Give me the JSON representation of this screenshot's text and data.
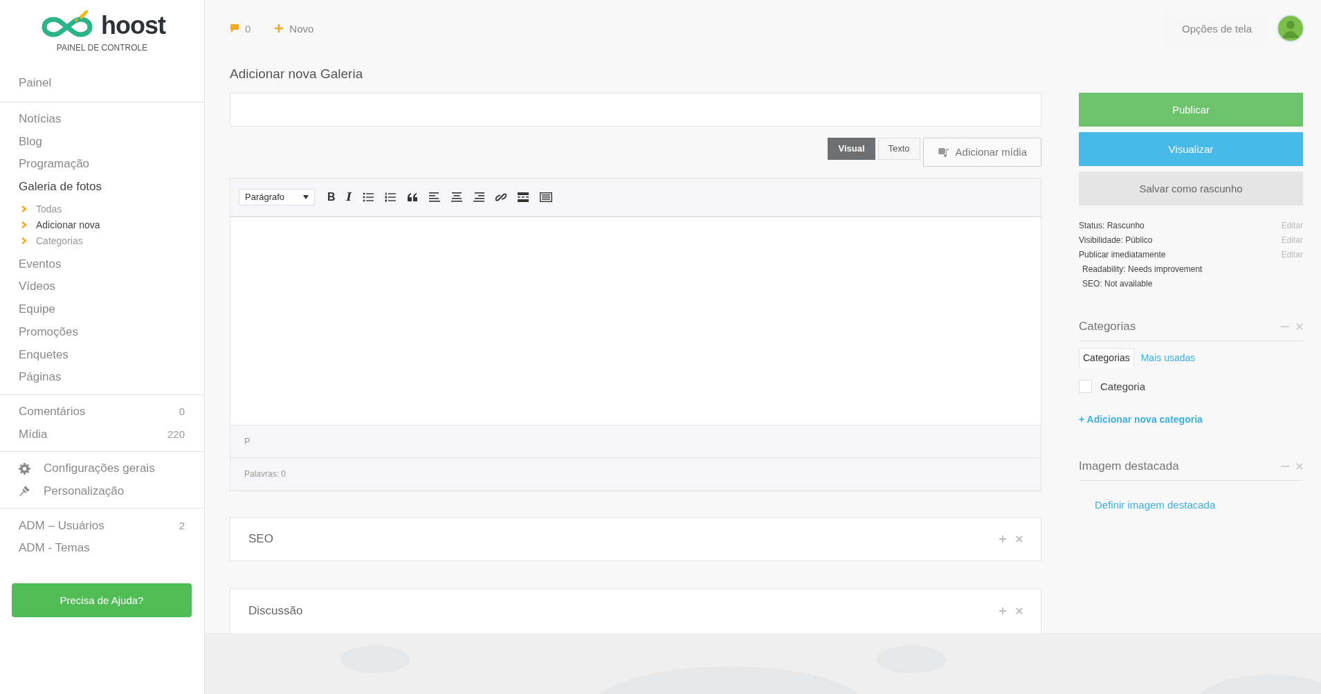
{
  "logo": {
    "wordmark": "hoost",
    "subtitle": "PAINEL DE CONTROLE"
  },
  "sidebar": {
    "sections": [
      {
        "items": [
          {
            "label": "Painel",
            "selected": false
          }
        ]
      },
      {
        "items": [
          {
            "label": "Notícias",
            "selected": false
          },
          {
            "label": "Blog",
            "selected": false
          },
          {
            "label": "Programação",
            "selected": false
          },
          {
            "label": "Galeria de fotos",
            "selected": true,
            "children": [
              {
                "label": "Todas",
                "selected": false
              },
              {
                "label": "Adicionar nova",
                "selected": true
              },
              {
                "label": "Categorias",
                "selected": false
              }
            ]
          },
          {
            "label": "Eventos",
            "selected": false
          },
          {
            "label": "Vídeos",
            "selected": false
          },
          {
            "label": "Equipe",
            "selected": false
          },
          {
            "label": "Promoções",
            "selected": false
          },
          {
            "label": "Enquetes",
            "selected": false
          },
          {
            "label": "Páginas",
            "selected": false
          }
        ]
      },
      {
        "items": [
          {
            "label": "Comentários",
            "count": "0",
            "selected": false
          },
          {
            "label": "Mídia",
            "count": "220",
            "selected": false
          }
        ]
      },
      {
        "items": [
          {
            "label": "Configurações gerais",
            "kind": "settings",
            "selected": false
          },
          {
            "label": "Personalização",
            "kind": "appearance",
            "selected": false
          }
        ]
      },
      {
        "items": [
          {
            "label": "ADM – Usuários",
            "count": "2",
            "selected": false
          },
          {
            "label": "ADM - Temas",
            "selected": false
          }
        ]
      }
    ],
    "help_button": "Precisa de Ajuda?"
  },
  "topbar": {
    "comments": "0",
    "new": "Novo",
    "screen_options": "Opções de tela"
  },
  "page_title": "Adicionar nova Galeria",
  "editor": {
    "tabs": [
      {
        "label": "Visual",
        "selected": true
      },
      {
        "label": "Texto",
        "selected": false
      }
    ],
    "add_media": "Adicionar mídia",
    "format": "Parágrafo",
    "bold": "B",
    "italic": "I",
    "path": "P",
    "word_count": "Palavras: 0"
  },
  "metaboxes": [
    {
      "title": "SEO"
    },
    {
      "title": "Discussão"
    }
  ],
  "publish": {
    "buttons": [
      {
        "kind": "publish",
        "label": "Publicar"
      },
      {
        "kind": "preview",
        "label": "Visualizar"
      },
      {
        "kind": "draft",
        "label": "Salvar como rascunho"
      }
    ],
    "rows": [
      {
        "text": "Status: Rascunho",
        "action": "Editar"
      },
      {
        "text": "Visibilidade: Público",
        "action": "Editar"
      },
      {
        "text": "Publicar imediatamente",
        "action": "Editar"
      }
    ],
    "notes": [
      "Readability: Needs improvement",
      "SEO: Not available"
    ]
  },
  "categories": {
    "title": "Categorias",
    "tabs": [
      {
        "label": "Categorias",
        "selected": true
      },
      {
        "label": "Mais usadas",
        "selected": false
      }
    ],
    "items": [
      {
        "label": "Categoria",
        "checked": false
      }
    ],
    "add_link": "+ Adicionar nova categoria"
  },
  "featured_image": {
    "title": "Imagem destacada",
    "link": "Definir imagem destacada"
  }
}
